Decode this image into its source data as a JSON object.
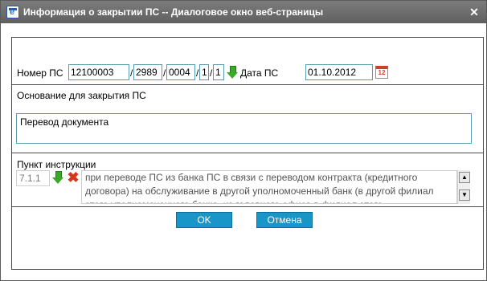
{
  "window": {
    "title": "Информация о закрытии ПС -- Диалоговое окно веб-страницы",
    "close_glyph": "✕"
  },
  "ps_number": {
    "label": "Номер ПС",
    "part1": "12100003",
    "part2": "2989",
    "part3": "0004",
    "part4": "1",
    "part5": "1",
    "separator": "/"
  },
  "ps_date": {
    "label": "Дата ПС",
    "value": "01.10.2012",
    "calendar_icon_text": "12"
  },
  "reason": {
    "label": "Основание для закрытия ПС",
    "value": "Перевод документа"
  },
  "instruction": {
    "label": "Пункт инструкции",
    "code": "7.1.1",
    "description": "при переводе ПС из банка ПС в связи с переводом контракта (кредитного договора) на обслуживание в другой уполномоченный банк (в другой филиал этого уполномоченного банка, из головного офиса в филиал этого"
  },
  "buttons": {
    "ok": "OK",
    "cancel": "Отмена"
  },
  "colors": {
    "titlebar": "#6e6e6e",
    "field_border": "#5a9bb0",
    "button_bg": "#1a95c8",
    "arrow_green": "#3aa92a",
    "delete_red": "#d8361f"
  },
  "icons": {
    "app": "ie-icon",
    "arrow": "green-down-arrow-icon",
    "calendar": "calendar-icon",
    "delete": "red-x-icon",
    "scroll_up": "scroll-up-icon",
    "scroll_down": "scroll-down-icon"
  }
}
